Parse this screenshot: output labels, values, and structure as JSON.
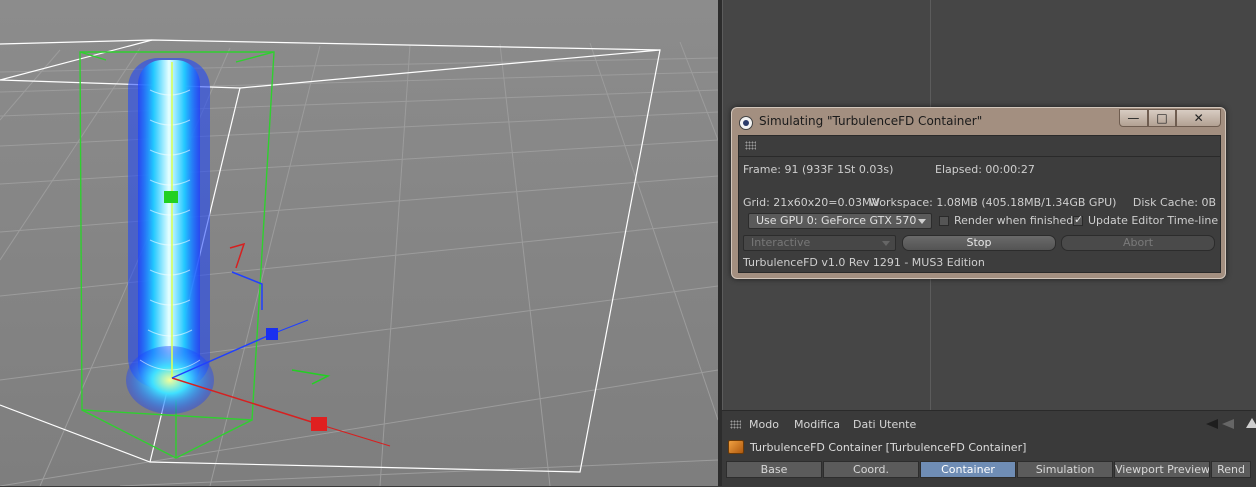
{
  "dialog": {
    "title": "Simulating \"TurbulenceFD Container\"",
    "frame": "Frame: 91 (933F 1St 0.03s)",
    "elapsed": "Elapsed: 00:00:27",
    "grid": "Grid: 21x60x20=0.03MV",
    "workspace": "Workspace: 1.08MB (405.18MB/1.34GB GPU)",
    "disk_cache": "Disk Cache: 0B",
    "gpu_select": "Use GPU 0: GeForce GTX 570",
    "render_when_finished": {
      "label": "Render when finished",
      "checked": false
    },
    "update_editor": {
      "label": "Update Editor Time-line",
      "checked": true
    },
    "mode_select": "Interactive",
    "stop_label": "Stop",
    "abort_label": "Abort",
    "footer": "TurbulenceFD v1.0 Rev 1291 - MUS3 Edition",
    "window_buttons": {
      "minimize": "—",
      "maximize": "□",
      "close": "✕"
    }
  },
  "attributes": {
    "menu": [
      "Modo",
      "Modifica",
      "Dati Utente"
    ],
    "object_name": "TurbulenceFD Container [TurbulenceFD Container]",
    "tabs": [
      "Base",
      "Coord.",
      "Container",
      "Simulation",
      "Viewport Preview",
      "Rend"
    ],
    "active_tab": "Container"
  },
  "colors": {
    "accent_tab": "#6f8db5",
    "dialog_frame": "#a38f80",
    "bbox_green": "#2fd02f"
  }
}
